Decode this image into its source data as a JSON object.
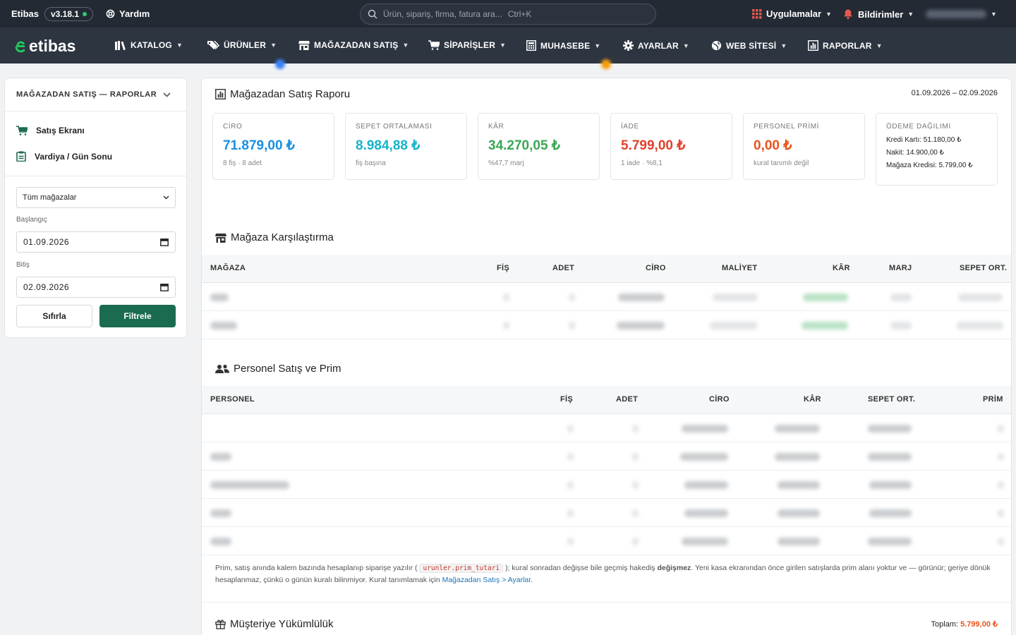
{
  "topbar": {
    "brand": "Etibas",
    "version": "v3.18.1",
    "help": "Yardım",
    "search_placeholder": "Ürün, sipariş, firma, fatura ara...",
    "search_shortcut": "Ctrl+K",
    "apps": "Uygulamalar",
    "notifications": "Bildirimler"
  },
  "nav": {
    "logo": "etibas",
    "items": [
      {
        "label": "KATALOG",
        "icon": "books-icon"
      },
      {
        "label": "ÜRÜNLER",
        "icon": "tag-icon"
      },
      {
        "label": "MAĞAZADAN SATIŞ",
        "icon": "store-icon"
      },
      {
        "label": "SİPARİŞLER",
        "icon": "cart-icon"
      },
      {
        "label": "MUHASEBE",
        "icon": "calculator-icon"
      },
      {
        "label": "AYARLAR",
        "icon": "gear-icon"
      },
      {
        "label": "WEB SİTESİ",
        "icon": "globe-icon"
      },
      {
        "label": "RAPORLAR",
        "icon": "report-icon"
      }
    ]
  },
  "sidebar": {
    "title": "MAĞAZADAN SATIŞ — RAPORLAR",
    "links": [
      {
        "label": "Satış Ekranı",
        "icon": "cart-icon"
      },
      {
        "label": "Vardiya / Gün Sonu",
        "icon": "clipboard-icon"
      }
    ],
    "store_select": "Tüm mağazalar",
    "start_label": "Başlangıç",
    "start_value": "01.09.2026",
    "end_label": "Bitiş",
    "end_value": "02.09.2026",
    "reset_label": "Sıfırla",
    "filter_label": "Filtrele"
  },
  "report": {
    "title": "Mağazadan Satış Raporu",
    "date_range": "01.09.2026 – 02.09.2026",
    "cards": [
      {
        "label": "CİRO",
        "value": "71.879,00 ₺",
        "sub": "8 fiş · 8 adet",
        "color": "#1a8fe3"
      },
      {
        "label": "SEPET ORTALAMASI",
        "value": "8.984,88 ₺",
        "sub": "fiş başına",
        "color": "#17b3c9"
      },
      {
        "label": "KÂR",
        "value": "34.270,05 ₺",
        "sub": "%47,7 marj",
        "color": "#3aa655"
      },
      {
        "label": "İADE",
        "value": "5.799,00 ₺",
        "sub": "1 iade · %8,1",
        "color": "#e0412b"
      },
      {
        "label": "PERSONEL PRİMİ",
        "value": "0,00 ₺",
        "sub": "kural tanımlı değil",
        "color": "#e8541d"
      }
    ],
    "payment": {
      "label": "ÖDEME DAĞILIMI",
      "lines": [
        "Kredi Kartı: 51.180,00 ₺",
        "Nakit: 14.900,00 ₺",
        "Mağaza Kredisi: 5.799,00 ₺"
      ]
    }
  },
  "store_comparison": {
    "title": "Mağaza Karşılaştırma",
    "columns": [
      "MAĞAZA",
      "FİŞ",
      "ADET",
      "CİRO",
      "MALİYET",
      "KÂR",
      "MARJ",
      "SEPET ORT."
    ]
  },
  "staff": {
    "title": "Personel Satış ve Prim",
    "columns": [
      "PERSONEL",
      "FİŞ",
      "ADET",
      "CİRO",
      "KÂR",
      "SEPET ORT.",
      "PRİM"
    ]
  },
  "note": {
    "text1": "Prim, satış anında kalem bazında hesaplanıp siparişe yazılır (",
    "code": "urunler.prim_tutari",
    "text2": "); kural sonradan değişse bile geçmiş hakediş ",
    "bold": "değişmez",
    "text3": ". Yeni kasa ekranından önce girilen satışlarda prim alanı yoktur ve — görünür; geriye dönük hesaplanmaz, çünkü o günün kuralı bilinmiyor. Kural tanımlamak için ",
    "link": "Mağazadan Satış > Ayarlar",
    "text4": "."
  },
  "liability": {
    "title": "Müşteriye Yükümlülük",
    "total_label": "Toplam: ",
    "total_value": "5.799,00 ₺"
  }
}
